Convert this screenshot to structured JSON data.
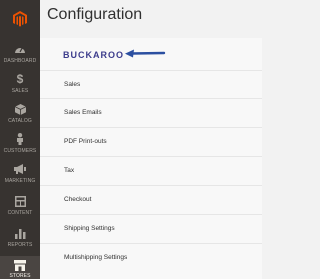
{
  "header": {
    "title": "Configuration"
  },
  "sidebar": {
    "items": [
      {
        "label": "DASHBOARD",
        "icon": "dashboard-icon"
      },
      {
        "label": "SALES",
        "icon": "dollar-icon"
      },
      {
        "label": "CATALOG",
        "icon": "cube-icon"
      },
      {
        "label": "CUSTOMERS",
        "icon": "person-icon"
      },
      {
        "label": "MARKETING",
        "icon": "megaphone-icon"
      },
      {
        "label": "CONTENT",
        "icon": "layout-icon"
      },
      {
        "label": "REPORTS",
        "icon": "bar-chart-icon"
      },
      {
        "label": "STORES",
        "icon": "store-icon"
      }
    ]
  },
  "main": {
    "brand": "BUCKAROO",
    "items": [
      "Sales",
      "Sales Emails",
      "PDF Print-outs",
      "Tax",
      "Checkout",
      "Shipping Settings",
      "Multishipping Settings"
    ]
  },
  "colors": {
    "sidebar_bg": "#373330",
    "accent_logo": "#eb5202",
    "brand_text": "#3c3c8c",
    "arrow": "#2b4fa0"
  }
}
